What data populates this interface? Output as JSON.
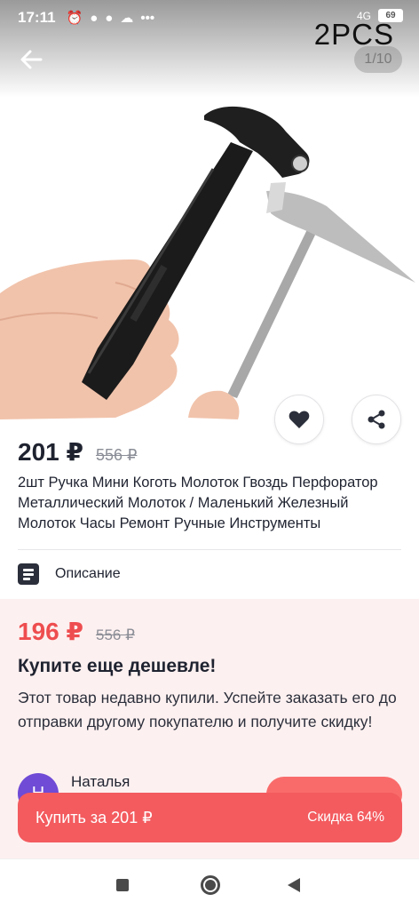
{
  "status_bar": {
    "time": "17:11",
    "icons": [
      "alarm-icon",
      "chat-icon",
      "chat-bubble-icon",
      "cloud-icon",
      "more-dots-icon"
    ],
    "battery": "69",
    "network": "4G"
  },
  "image_overlay_text": "2PCS",
  "gallery": {
    "counter": "1/10"
  },
  "product": {
    "price": "201 ₽",
    "old_price": "556 ₽",
    "title": "2шт Ручка Мини Коготь Молоток Гвоздь Перфоратор Металлический Молоток / Маленький Железный Молоток Часы Ремонт Ручные Инструменты"
  },
  "description_link": "Описание",
  "promo": {
    "price": "196 ₽",
    "old_price": "556 ₽",
    "title": "Купите еще дешевле!",
    "text": "Этот товар недавно купили. Успейте заказать его до отправки другому покупателю и получите скидку!",
    "buyer_name": "Наталья",
    "buyer_initial": "Н"
  },
  "buy_bar": {
    "label": "Купить за 201 ₽",
    "discount": "Скидка 64%"
  },
  "colors": {
    "accent": "#f35b5f",
    "promo_price": "#ee4d4f",
    "promo_bg": "#fdf0f0",
    "avatar": "#6f4bd6"
  }
}
